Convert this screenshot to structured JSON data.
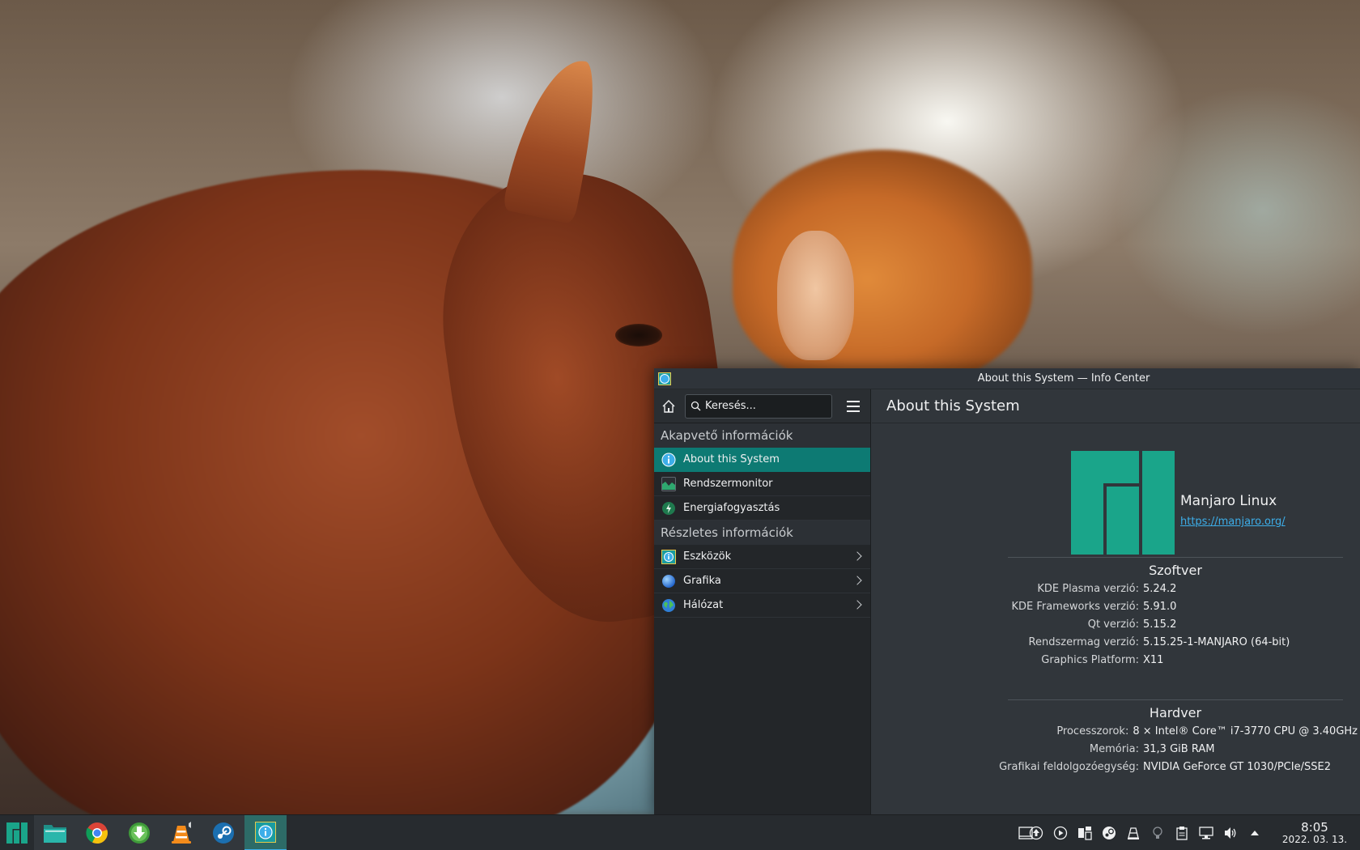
{
  "window": {
    "title": "About this System — Info Center"
  },
  "sidebar": {
    "search_placeholder": "Keresés...",
    "sections": [
      {
        "title": "Akapvető információk",
        "items": [
          {
            "label": "About this System",
            "icon": "info-icon",
            "active": true
          },
          {
            "label": "Rendszermonitor",
            "icon": "system-monitor-icon"
          },
          {
            "label": "Energiafogyasztás",
            "icon": "energy-icon"
          }
        ]
      },
      {
        "title": "Részletes információk",
        "items": [
          {
            "label": "Eszközök",
            "icon": "devices-icon"
          },
          {
            "label": "Grafika",
            "icon": "graphics-icon"
          },
          {
            "label": "Hálózat",
            "icon": "network-icon"
          }
        ]
      }
    ]
  },
  "main": {
    "title": "About this System",
    "distro_name": "Manjaro Linux",
    "distro_url": "https://manjaro.org/",
    "software": {
      "title": "Szoftver",
      "rows": [
        {
          "key": "KDE Plasma verzió:",
          "value": "5.24.2"
        },
        {
          "key": "KDE Frameworks verzió:",
          "value": "5.91.0"
        },
        {
          "key": "Qt verzió:",
          "value": "5.15.2"
        },
        {
          "key": "Rendszermag verzió:",
          "value": "5.15.25-1-MANJARO (64-bit)"
        },
        {
          "key": "Graphics Platform:",
          "value": "X11"
        }
      ]
    },
    "hardware": {
      "title": "Hardver",
      "rows": [
        {
          "key": "Processzorok:",
          "value": "8 × Intel® Core™ i7-3770 CPU @ 3.40GHz"
        },
        {
          "key": "Memória:",
          "value": "31,3 GiB RAM"
        },
        {
          "key": "Grafikai feldolgozóegység:",
          "value": "NVIDIA GeForce GT 1030/PCIe/SSE2"
        }
      ]
    }
  },
  "taskbar": {
    "tasks": [
      "application-launcher-icon",
      "file-manager-icon",
      "chrome-icon",
      "download-manager-icon",
      "vlc-icon",
      "steam-icon",
      "info-center-icon"
    ],
    "clock_time": "8:05",
    "clock_date": "2022. 03. 13."
  },
  "colors": {
    "accent": "#0d7a73",
    "manjaro_green": "#1aa58a",
    "link": "#3daee9"
  }
}
